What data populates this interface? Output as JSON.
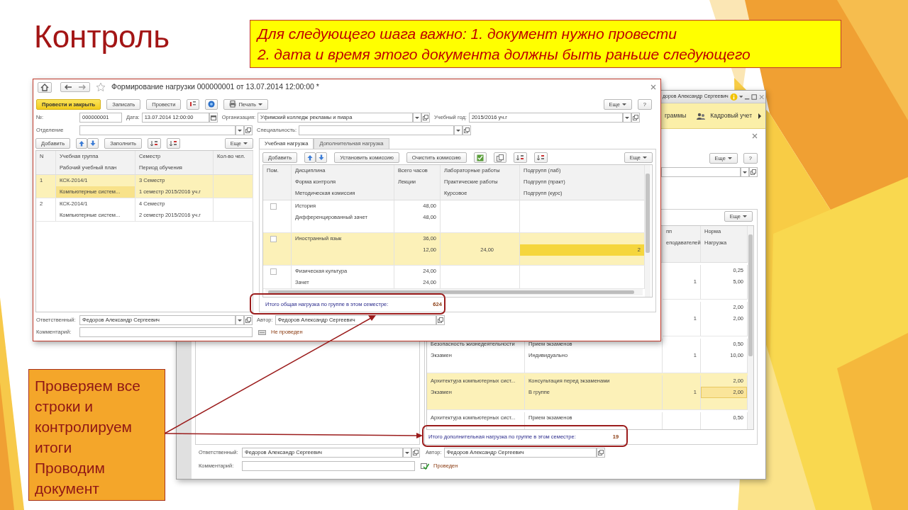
{
  "slide": {
    "title": "Контроль",
    "note": [
      "Для следующего шага важно: 1. документ нужно провести",
      "2. дата и время этого документа должны быть раньше следующего"
    ],
    "callout": [
      "Проверяем все строки и контролируем итоги",
      "Проводим документ"
    ]
  },
  "front_window": {
    "title": "Формирование нагрузки 000000001 от 13.07.2014 12:00:00 *",
    "buttons": [
      {
        "label": "Провести и закрыть",
        "primary": true
      },
      {
        "label": "Записать",
        "primary": false
      },
      {
        "label": "Провести",
        "primary": false
      }
    ],
    "print_label": "Печать",
    "more_label": "Еще",
    "help_label": "?",
    "header_fields": [
      [
        {
          "label": "№:",
          "value": "000000001",
          "kind": "text"
        },
        {
          "label": "Дата:",
          "value": "13.07.2014 12:00:00",
          "kind": "date"
        },
        {
          "label": "Организация:",
          "value": "Уфимский колледж рекламы и пиара",
          "kind": "select"
        },
        {
          "label": "Учебный год:",
          "value": "2015/2016 уч.г",
          "kind": "select"
        }
      ],
      [
        {
          "label": "Отделение",
          "kind": "select"
        },
        {
          "label": "Специальность:",
          "kind": "select"
        }
      ]
    ],
    "groups": {
      "add_label": "Добавить",
      "fill_label": "Заполнить",
      "more_label": "Еще",
      "columns": [
        [
          "N"
        ],
        [
          "Учебная группа",
          "Рабочий учебный план"
        ],
        [
          "Семестр",
          "Период обучения"
        ],
        [
          "Кол-во чел."
        ]
      ],
      "rows": [
        {
          "selected": true,
          "lines": [
            {
              "n": "1",
              "group": "КСК-2014/1",
              "semester": "3 Семестр",
              "focused": false
            },
            {
              "group": "Компьютерные систем...",
              "semester": "1 семестр 2015/2016 уч.г",
              "focused": true
            }
          ]
        },
        {
          "selected": false,
          "lines": [
            {
              "n": "2",
              "group": "КСК-2014/1",
              "semester": "4 Семестр",
              "focused": false
            },
            {
              "group": "Компьютерные систем...",
              "semester": "2 семестр 2015/2016 уч.г",
              "focused": false
            }
          ]
        }
      ]
    },
    "tabs": [
      {
        "label": "Учебная нагрузка",
        "selected": true
      },
      {
        "label": "Дополнительная нагрузка",
        "selected": false
      }
    ],
    "load": {
      "add_label": "Добавить",
      "set_label": "Установить комиссию",
      "clear_label": "Очистить комиссию",
      "more_label": "Еще",
      "columns": [
        [
          "Пом."
        ],
        [
          "Дисциплина",
          "Форма контроля",
          "Методическая комиссия"
        ],
        [
          "Всего часов",
          "Лекции"
        ],
        [
          "Лабораторные работы",
          "Практические работы",
          "Курсовое"
        ],
        [
          "Подгрупп (лаб)",
          "Подгрупп (практ)",
          "Подгрупп (курс)"
        ]
      ],
      "rows": [
        {
          "checked": false,
          "selected": false,
          "lines": [
            {
              "discipline": "История",
              "hours": "48,00",
              "focused": false
            },
            {
              "discipline": "Дифференцированный зачет",
              "hours": "48,00",
              "focused": false
            }
          ]
        },
        {
          "checked": false,
          "selected": true,
          "lines": [
            {
              "discipline": "Иностранный язык",
              "hours": "36,00",
              "focused": false
            },
            {
              "hours": "12,00",
              "labs": "24,00",
              "subgroups": "2",
              "focused": true
            }
          ]
        },
        {
          "checked": false,
          "selected": false,
          "lines": [
            {
              "discipline": "Физическая культура",
              "hours": "24,00",
              "focused": false
            },
            {
              "discipline": "Зачет",
              "hours": "24,00",
              "focused": false
            }
          ]
        }
      ],
      "total": {
        "label": "Итого общая нагрузка по группе в этом семестре:",
        "value": "624"
      }
    },
    "footer_fields": [
      [
        {
          "label": "Ответственный:",
          "value": "Федоров Александр Сергеевич",
          "kind": "select"
        },
        {
          "label": "Автор:",
          "value": "Федоров Александр Сергеевич",
          "kind": "link"
        }
      ],
      [
        {
          "label": "Комментарий:",
          "kind": "text"
        }
      ]
    ],
    "status": {
      "text": "Не проведен",
      "posted": false
    }
  },
  "back_window": {
    "user": "доров Александр Сергеевич",
    "sections": [
      "граммы",
      "Кадровый учет"
    ],
    "more_label": "Еще",
    "help_label": "?",
    "table": {
      "more_label": "Еще",
      "columns": [
        [],
        [],
        [
          "пп",
          "еподавателей"
        ],
        [
          "Норма",
          "Нагрузка"
        ]
      ],
      "rows": [
        {
          "selected": false,
          "lines": [
            {
              "col_4": "0,25",
              "focused": false
            },
            {
              "col_3": "1",
              "col_4": "5,00",
              "focused": false
            }
          ]
        },
        {
          "selected": false,
          "lines": [
            {
              "col_4": "2,00",
              "focused": false
            },
            {
              "col_3": "1",
              "col_4": "2,00",
              "focused": false
            }
          ]
        },
        {
          "selected": false,
          "lines": [
            {
              "col_1": "Безопасность жизнедеятельности",
              "col_2": "Прием экзаменов",
              "col_4": "0,50",
              "focused": false
            },
            {
              "col_1": "Экзамен",
              "col_2": "Индивидуально",
              "col_3": "1",
              "col_4": "10,00",
              "focused": false
            }
          ]
        },
        {
          "selected": true,
          "lines": [
            {
              "col_1": "Архитектура компьютерных сист...",
              "col_2": "Консультация перед экзаменами",
              "col_4": "2,00",
              "focused": false
            },
            {
              "col_1": "Экзамен",
              "col_2": "В группе",
              "col_3": "1",
              "col_4": "2,00",
              "focused": true
            }
          ]
        },
        {
          "selected": false,
          "lines": [
            {
              "col_1": "Архитектура компьютерных сист...",
              "col_2": "Прием экзаменов",
              "col_4": "0,50",
              "focused": false
            }
          ]
        }
      ],
      "total": {
        "label": "Итого дополнительная нагрузка по группе в этом семестре:",
        "value": "19"
      }
    },
    "footer_fields": [
      [
        {
          "label": "Ответственный:",
          "value": "Федоров Александр Сергеевич",
          "kind": "select"
        },
        {
          "label": "Автор:",
          "value": "Федоров Александр Сергеевич",
          "kind": "link"
        }
      ],
      [
        {
          "label": "Комментарий:",
          "kind": "text"
        }
      ]
    ],
    "status": {
      "text": "Проведен",
      "posted": true
    }
  }
}
